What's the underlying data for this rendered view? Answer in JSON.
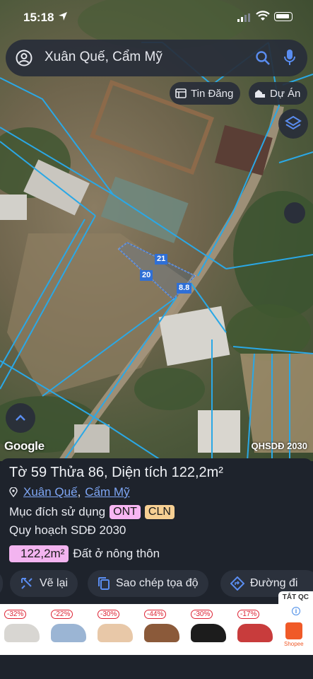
{
  "status_bar": {
    "time": "15:18"
  },
  "search": {
    "query": "Xuân Quế, Cẩm Mỹ"
  },
  "chips": {
    "tin_dang": "Tin Đăng",
    "du_an": "Dự Án"
  },
  "map": {
    "attribution": "Google",
    "layer_label": "QHSDĐ 2030",
    "dimensions": [
      "21",
      "20",
      "8.8"
    ]
  },
  "parcel": {
    "title": "Tờ 59 Thửa 86, Diện tích 122,2m²",
    "address": {
      "commune": "Xuân Quế",
      "comma": ",",
      "district": "Cẩm Mỹ"
    },
    "purpose_label": "Mục đích sử dụng",
    "purpose_tags": [
      "ONT",
      "CLN"
    ],
    "plan_label": "Quy hoạch SDĐ 2030",
    "area_value": "122,2m²",
    "area_type": "Đất ở nông thôn"
  },
  "actions": {
    "redraw": "Vẽ lại",
    "copy_coords": "Sao chép tọa độ",
    "directions": "Đường đi"
  },
  "ad": {
    "close_label": "TẮT QC",
    "brand": "Shopee",
    "discounts": [
      "-32%",
      "-22%",
      "-30%",
      "-44%",
      "-30%",
      "-17%"
    ],
    "shoe_colors": [
      "#d8d6d2",
      "#9bb5d4",
      "#e8c8a8",
      "#8b5a3a",
      "#1c1c1c",
      "#c83c3c"
    ]
  },
  "colors": {
    "accent": "#7ea6f4",
    "map_lines": "#2aa8e6",
    "parcel_line": "#2f6fd6"
  }
}
